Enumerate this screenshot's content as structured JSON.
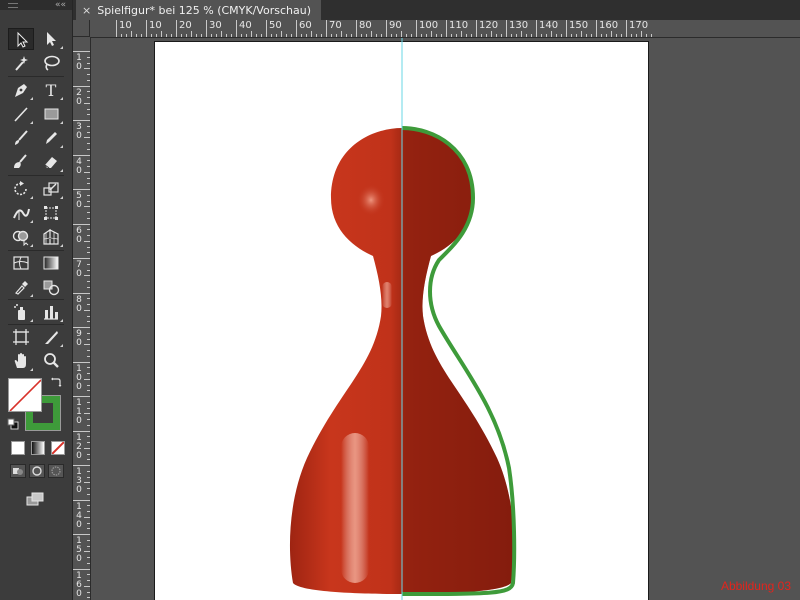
{
  "document": {
    "tab_title": "Spielfigur* bei 125 % (CMYK/Vorschau)",
    "close_symbol": "×"
  },
  "rulers": {
    "horizontal_labels": [
      "10",
      "10",
      "20",
      "30",
      "40",
      "50",
      "60",
      "70",
      "80",
      "90",
      "100",
      "110",
      "120",
      "130",
      "140",
      "150",
      "160",
      "170"
    ],
    "vertical_labels": [
      "1",
      "0",
      "2",
      "0",
      "3",
      "0",
      "4",
      "0",
      "5",
      "0",
      "6",
      "0",
      "7",
      "0",
      "8",
      "0",
      "9",
      "0",
      "1",
      "0",
      "0",
      "1",
      "1",
      "0",
      "1",
      "2",
      "0",
      "1",
      "3",
      "0",
      "1",
      "4",
      "0",
      "1",
      "5",
      "0",
      "1",
      "6",
      "0"
    ]
  },
  "tools": [
    {
      "name": "selection-tool",
      "icon": "arrow-icon"
    },
    {
      "name": "direct-selection-tool",
      "icon": "white-arrow-icon"
    },
    {
      "name": "magic-wand-tool",
      "icon": "magic-wand-icon"
    },
    {
      "name": "lasso-tool",
      "icon": "lasso-icon"
    },
    {
      "name": "pen-tool",
      "icon": "pen-icon"
    },
    {
      "name": "type-tool",
      "icon": "type-icon"
    },
    {
      "name": "line-tool",
      "icon": "line-icon"
    },
    {
      "name": "rectangle-tool",
      "icon": "rectangle-icon"
    },
    {
      "name": "paintbrush-tool",
      "icon": "brush-icon"
    },
    {
      "name": "pencil-tool",
      "icon": "pencil-icon"
    },
    {
      "name": "blob-brush-tool",
      "icon": "blob-brush-icon"
    },
    {
      "name": "eraser-tool",
      "icon": "eraser-icon"
    },
    {
      "name": "rotate-tool",
      "icon": "rotate-icon"
    },
    {
      "name": "scale-tool",
      "icon": "scale-icon"
    },
    {
      "name": "width-tool",
      "icon": "width-icon"
    },
    {
      "name": "free-transform-tool",
      "icon": "free-transform-icon"
    },
    {
      "name": "shape-builder-tool",
      "icon": "shape-builder-icon"
    },
    {
      "name": "perspective-grid-tool",
      "icon": "perspective-grid-icon"
    },
    {
      "name": "mesh-tool",
      "icon": "mesh-icon"
    },
    {
      "name": "gradient-tool",
      "icon": "gradient-icon"
    },
    {
      "name": "eyedropper-tool",
      "icon": "eyedropper-icon"
    },
    {
      "name": "blend-tool",
      "icon": "blend-icon"
    },
    {
      "name": "symbol-sprayer-tool",
      "icon": "symbol-sprayer-icon"
    },
    {
      "name": "column-graph-tool",
      "icon": "column-graph-icon"
    },
    {
      "name": "artboard-tool",
      "icon": "artboard-icon"
    },
    {
      "name": "slice-tool",
      "icon": "slice-icon"
    },
    {
      "name": "hand-tool",
      "icon": "hand-icon"
    },
    {
      "name": "zoom-tool",
      "icon": "zoom-icon"
    }
  ],
  "colors": {
    "fill": "#ffffff",
    "fill_none_slash": "#d8322a",
    "stroke": "#3e9b3a",
    "figure_red": "#c0321a",
    "figure_dark": "#8e1f10",
    "guide": "#6ad7e6",
    "caption": "#e4241c"
  },
  "caption": "Abbildung 03"
}
